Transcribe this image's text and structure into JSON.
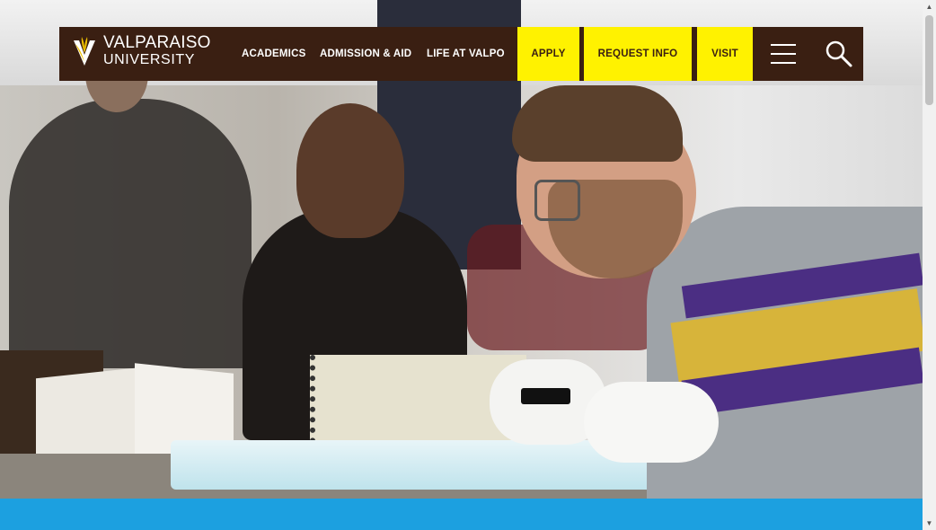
{
  "site": {
    "logo_line1": "VALPARAISO",
    "logo_line2": "UNIVERSITY"
  },
  "nav": {
    "academics": "ACADEMICS",
    "admission": "ADMISSION & AID",
    "life": "LIFE AT VALPO"
  },
  "cta": {
    "apply": "APPLY",
    "request_info": "REQUEST INFO",
    "visit": "VISIT"
  },
  "icons": {
    "logo": "torch-shield-icon",
    "menu": "hamburger-menu-icon",
    "search": "search-icon",
    "scroll_up": "arrow-up-icon",
    "scroll_down": "arrow-down-icon"
  },
  "colors": {
    "header_bg": "#3a1f12",
    "cta_bg": "#fff200",
    "band": "#1ca0e0",
    "logo_gold": "#f2c300"
  }
}
